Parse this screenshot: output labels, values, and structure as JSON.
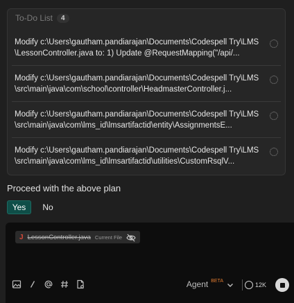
{
  "todo": {
    "title": "To-Do List",
    "count": "4",
    "items": [
      {
        "text": "Modify c:\\Users\\gautham.pandiarajan\\Documents\\Codespell Try\\LMS\\LessonController.java to: 1) Update @RequestMapping(\"/api/..."
      },
      {
        "text": "Modify c:\\Users\\gautham.pandiarajan\\Documents\\Codespell Try\\LMS\\src\\main\\java\\com\\school\\controller\\HeadmasterController.j..."
      },
      {
        "text": "Modify c:\\Users\\gautham.pandiarajan\\Documents\\Codespell Try\\LMS\\src\\main\\java\\com\\lms_id\\lmsartifactid\\entity\\AssignmentsE..."
      },
      {
        "text": "Modify c:\\Users\\gautham.pandiarajan\\Documents\\Codespell Try\\LMS\\src\\main\\java\\com\\lms_id\\lmsartifactid\\utilities\\CustomRsqlV..."
      }
    ]
  },
  "prompt": {
    "question": "Proceed with the above plan",
    "yes_label": "Yes",
    "no_label": "No"
  },
  "composer": {
    "file_chip": {
      "icon_letter": "J",
      "name": "LessonController.java",
      "tag": "Current File"
    },
    "toolbar_icons": [
      "image-icon",
      "slash-icon",
      "at-icon",
      "hash-icon",
      "document-icon"
    ],
    "agent_label": "Agent",
    "beta_label": "BETA",
    "token_count": "12K"
  },
  "colors": {
    "background": "#1f1f1f",
    "panel": "#262626",
    "yes_button": "#0f4e48",
    "beta": "#e07a2f",
    "java_icon": "#d94a3a"
  }
}
